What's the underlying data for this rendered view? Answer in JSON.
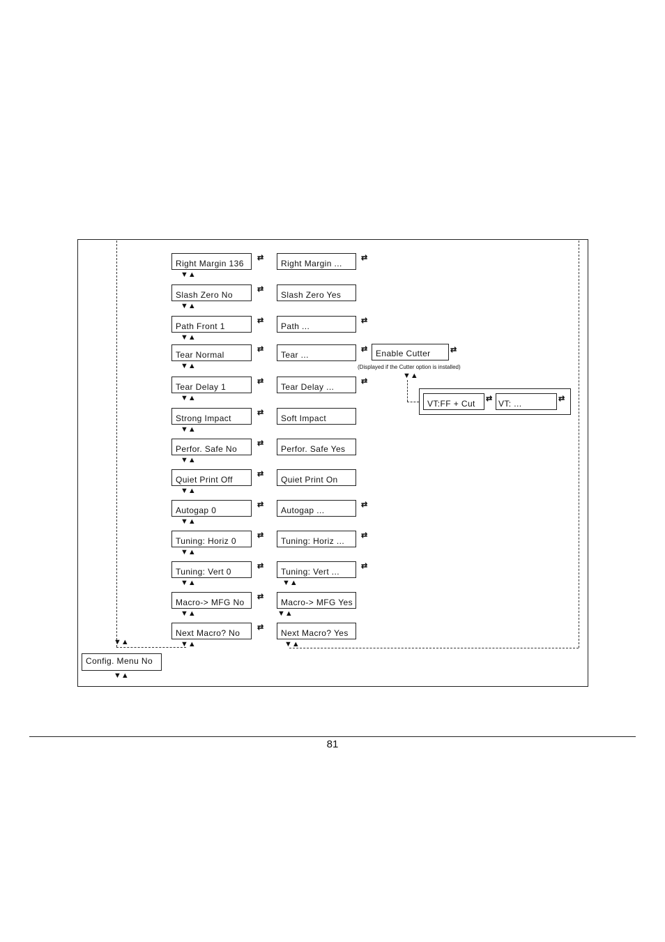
{
  "diagram": {
    "left_column": [
      "Right Margin 136",
      "Slash Zero  No",
      "Path Front 1",
      "Tear Normal",
      "Tear Delay 1",
      "Strong Impact",
      "Perfor. Safe No",
      "Quiet Print Off",
      "Autogap 0",
      "Tuning: Horiz  0",
      "Tuning: Vert 0",
      "Macro-> MFG No",
      "Next Macro? No"
    ],
    "right_column": [
      "Right Margin ...",
      "Slash Zero  Yes",
      "Path ...",
      "Tear ...",
      "Tear Delay ...",
      "Soft Impact",
      "Perfor. Safe Yes",
      "Quiet Print On",
      "Autogap ...",
      "Tuning: Horiz  ...",
      "Tuning: Vert ...",
      "Macro-> MFG Yes",
      "Next Macro? Yes"
    ],
    "config_menu": "Config. Menu No",
    "enable_cutter": "Enable Cutter",
    "cutter_note": "(Displayed if the Cutter option is installed)",
    "vt_ff_cut": "VT:FF + Cut",
    "vt_more": "VT: ...",
    "arrow_updown": "▼▲",
    "arrow_leftright": "⇄"
  },
  "footer": {
    "page_number": "81"
  }
}
